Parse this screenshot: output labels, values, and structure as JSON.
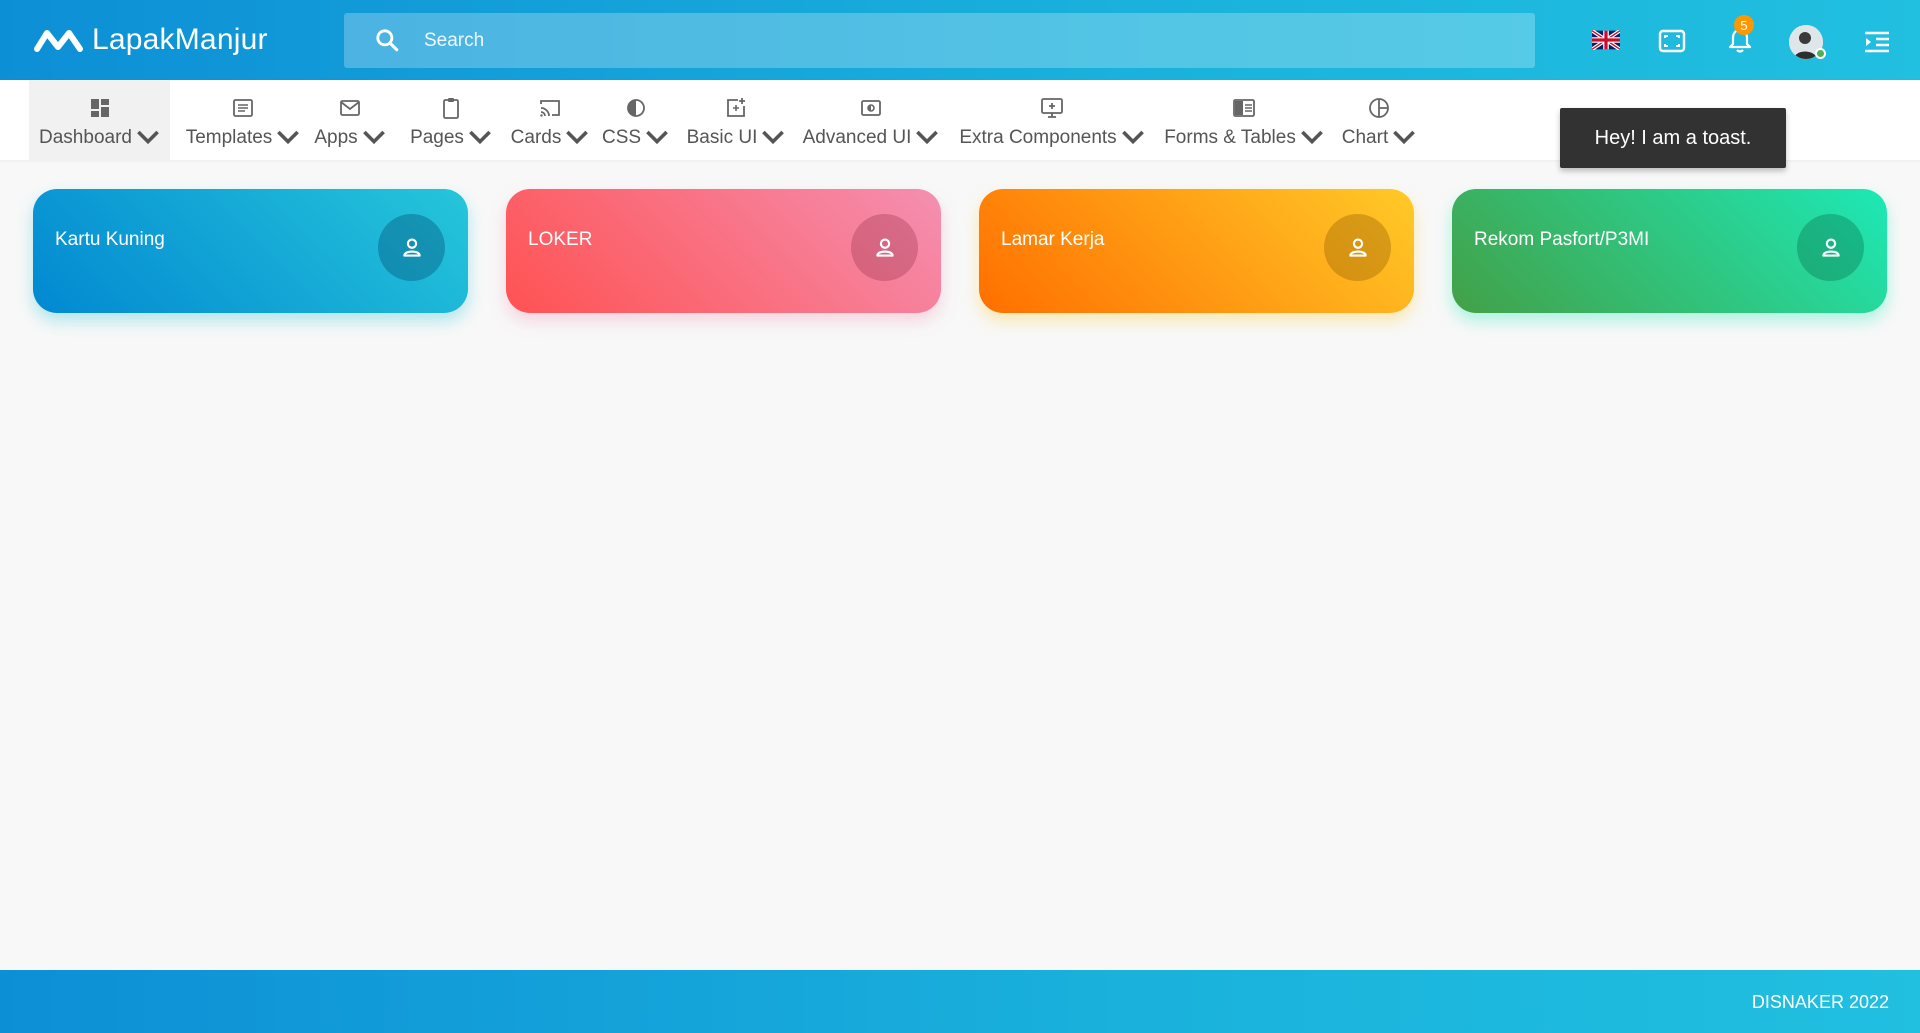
{
  "app": {
    "brand_name": "LapakManjur"
  },
  "search": {
    "placeholder": "Search"
  },
  "header": {
    "notification_count": "5",
    "icons": [
      "flag-uk-icon",
      "fullscreen-icon",
      "bell-icon",
      "avatar",
      "menu-toggle-icon"
    ]
  },
  "nav": {
    "items": [
      {
        "label": "Dashboard",
        "icon": "dashboard-icon",
        "active": true
      },
      {
        "label": "Templates",
        "icon": "templates-icon"
      },
      {
        "label": "Apps",
        "icon": "mail-icon"
      },
      {
        "label": "Pages",
        "icon": "clipboard-icon"
      },
      {
        "label": "Cards",
        "icon": "cast-icon"
      },
      {
        "label": "CSS",
        "icon": "contrast-icon"
      },
      {
        "label": "Basic UI",
        "icon": "add-box-icon"
      },
      {
        "label": "Advanced UI",
        "icon": "slider-icon"
      },
      {
        "label": "Extra Components",
        "icon": "monitor-plus-icon"
      },
      {
        "label": "Forms & Tables",
        "icon": "chrome-reader-icon"
      },
      {
        "label": "Chart",
        "icon": "pie-chart-icon"
      }
    ]
  },
  "toast": {
    "text": "Hey! I am a toast."
  },
  "cards": [
    {
      "title": "Kartu Kuning",
      "icon": "person-icon",
      "color": "#0288d1"
    },
    {
      "title": "LOKER",
      "icon": "person-icon",
      "color": "#ff5252"
    },
    {
      "title": "Lamar Kerja",
      "icon": "person-icon",
      "color": "#ff6f00"
    },
    {
      "title": "Rekom Pasfort/P3MI",
      "icon": "person-icon",
      "color": "#43a047"
    }
  ],
  "footer": {
    "text": "DISNAKER 2022"
  },
  "colors": {
    "primary": "#0d8fd6",
    "primary_light": "#21bfe0",
    "toast_bg": "#323232",
    "badge": "#ff9800"
  }
}
